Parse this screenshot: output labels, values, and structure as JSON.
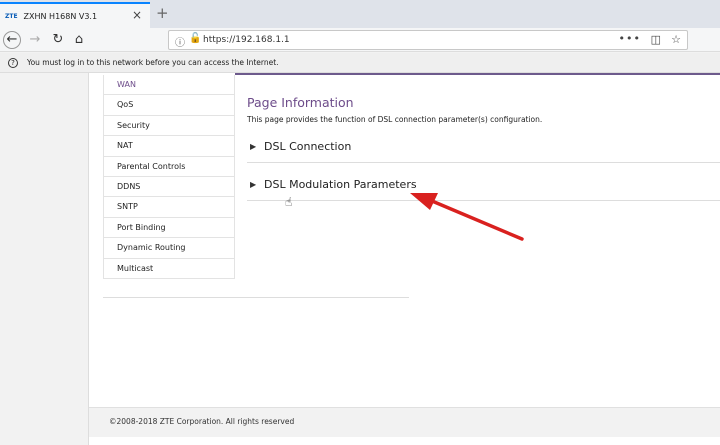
{
  "browser": {
    "tab_favicon": "ZTE",
    "tab_title": "ZXHN H168N V3.1",
    "tab_close": "×",
    "new_tab": "+",
    "url": "https://192.168.1.1",
    "back_icon": "←",
    "forward_icon": "→",
    "reload_icon": "↻",
    "home_icon": "⌂",
    "more_icon": "•••",
    "pocket_icon": "◫",
    "star_icon": "☆"
  },
  "notice": {
    "icon": "?",
    "text": "You must log in to this network before you can access the Internet."
  },
  "sidebar": {
    "items": [
      {
        "label": "WAN"
      },
      {
        "label": "QoS"
      },
      {
        "label": "Security"
      },
      {
        "label": "NAT"
      },
      {
        "label": "Parental Controls"
      },
      {
        "label": "DDNS"
      },
      {
        "label": "SNTP"
      },
      {
        "label": "Port Binding"
      },
      {
        "label": "Dynamic Routing"
      },
      {
        "label": "Multicast"
      }
    ]
  },
  "main": {
    "title": "Page Information",
    "description": "This page provides the function of DSL connection parameter(s) configuration.",
    "sections": [
      {
        "label": "DSL Connection"
      },
      {
        "label": "DSL Modulation Parameters"
      }
    ]
  },
  "footer": {
    "copyright": "©2008-2018 ZTE Corporation. All rights reserved"
  },
  "annotation": {
    "arrow_color": "#d9211f"
  }
}
